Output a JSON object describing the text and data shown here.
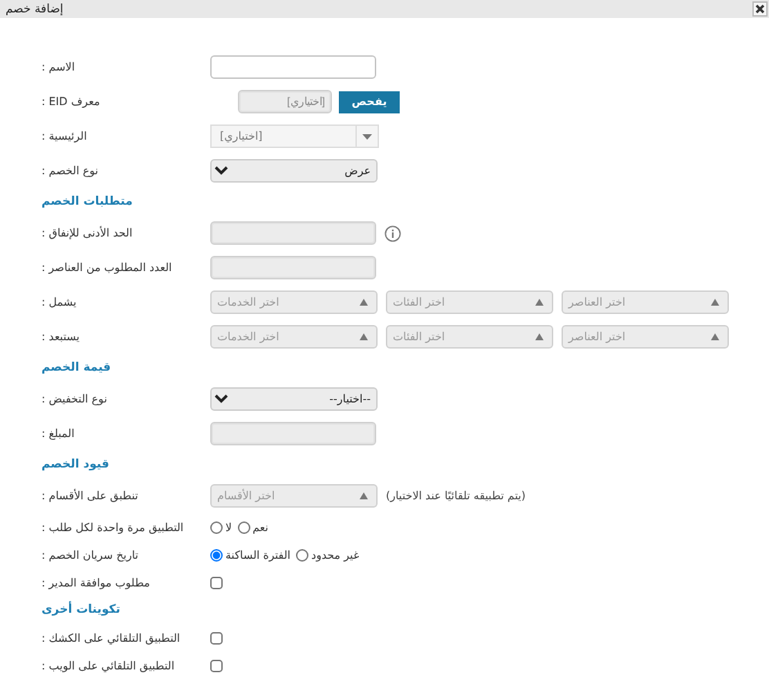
{
  "window": {
    "title": "إضافة خصم"
  },
  "rows": [
    {
      "kind": "text",
      "label": "الاسم :",
      "disabled": false,
      "info": false
    },
    {
      "kind": "eid",
      "label": "معرف EID :",
      "placeholder": "[اختياري]",
      "button": "يفحص"
    },
    {
      "kind": "combo",
      "label": "الرئيسية :",
      "placeholder": "[اختياري]"
    },
    {
      "kind": "select",
      "label": "نوع الخصم :",
      "value": "عرض"
    },
    {
      "kind": "heading",
      "text": "متطلبات الخصم"
    },
    {
      "kind": "text",
      "label": "الحد الأدنى للإنفاق :",
      "disabled": true,
      "info": true
    },
    {
      "kind": "text",
      "label": "العدد المطلوب من العناصر :",
      "disabled": true,
      "info": false
    },
    {
      "kind": "multi",
      "label": "يشمل :",
      "pickers": [
        "اختر العناصر",
        "اختر الفئات",
        "اختر الخدمات"
      ]
    },
    {
      "kind": "multi",
      "label": "يستبعد :",
      "pickers": [
        "اختر العناصر",
        "اختر الفئات",
        "اختر الخدمات"
      ]
    },
    {
      "kind": "heading",
      "text": "قيمة الخصم"
    },
    {
      "kind": "select",
      "label": "نوع التخفيض :",
      "value": "--اختيار--"
    },
    {
      "kind": "text",
      "label": "المبلغ :",
      "disabled": true,
      "info": false
    },
    {
      "kind": "heading",
      "text": "قيود الخصم"
    },
    {
      "kind": "multi",
      "label": "تنطبق على الأقسام :",
      "pickers": [
        "اختر الأقسام"
      ],
      "note": "(يتم تطبيقه تلقائيًا عند الاختيار)"
    },
    {
      "kind": "radio",
      "label": "التطبيق مرة واحدة لكل طلب :",
      "options": [
        {
          "label": "نعم",
          "selected": false
        },
        {
          "label": "لا",
          "selected": false
        }
      ]
    },
    {
      "kind": "radio",
      "label": "تاريخ سريان الخصم :",
      "options": [
        {
          "label": "غير محدود",
          "selected": false
        },
        {
          "label": "الفترة الساكنة",
          "selected": true
        }
      ]
    },
    {
      "kind": "checkbox",
      "label": "مطلوب موافقة المدير :",
      "checked": false
    },
    {
      "kind": "heading",
      "text": "تكوينات أخرى"
    },
    {
      "kind": "checkbox",
      "label": "التطبيق التلقائي على الكشك :",
      "checked": false
    },
    {
      "kind": "checkbox",
      "label": "التطبيق التلقائي على الويب :",
      "checked": false
    }
  ]
}
